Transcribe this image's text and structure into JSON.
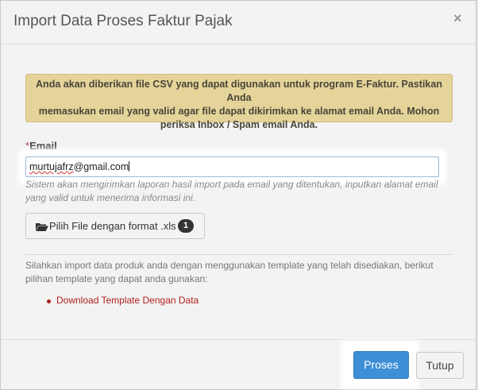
{
  "modal": {
    "title": "Import Data Proses Faktur Pajak",
    "close_symbol": "×"
  },
  "alert": {
    "line1": "Anda akan diberikan file CSV yang dapat digunakan untuk program E-Faktur. Pastikan Anda",
    "line2": "memasukan email yang valid agar file dapat dikirimkan ke alamat email Anda. Mohon",
    "line3": "periksa Inbox / Spam email Anda."
  },
  "email": {
    "required_mark": "*",
    "label": "Email",
    "value_misspelled": "murtujafrz",
    "value_rest": "@gmail.com",
    "hint_line1": "Sistem akan mengirimkan laporan hasil import pada email yang ditentukan, inputkan alamat email",
    "hint_line2": "yang valid untuk menerima informasi ini."
  },
  "file_button": {
    "icon": "folder-open-icon",
    "label": "Pilih File dengan format .xls",
    "badge": "1"
  },
  "info": {
    "line1": "Silahkan import data produk anda dengan menggunakan template yang telah disediakan, berikut",
    "line2": "pilihan template yang dapat anda gunakan:"
  },
  "templates": [
    {
      "label": "Download Template Dengan Data"
    }
  ],
  "footer": {
    "proses_label": "Proses",
    "tutup_label": "Tutup"
  },
  "colors": {
    "alert_bg": "#e5d49a",
    "primary": "#3d8fd6",
    "link": "#b01e1e",
    "required": "#c23b3b"
  }
}
